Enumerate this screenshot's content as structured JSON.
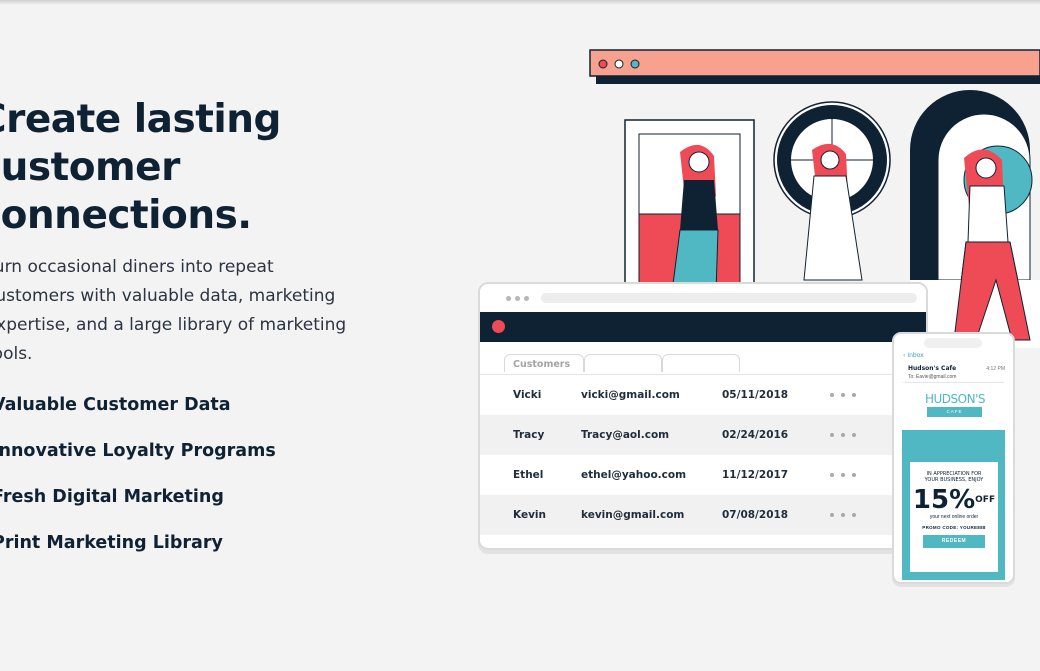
{
  "hero": {
    "title_lines": [
      "Create lasting",
      "customer",
      "connections."
    ],
    "copy_lines": [
      "Turn occasional diners into repeat",
      "customers with valuable data, marketing",
      "expertise, and a large library of marketing",
      "tools."
    ]
  },
  "features": [
    "Valuable Customer Data",
    "Innovative Loyalty Programs",
    "Fresh Digital Marketing",
    "Print Marketing Library"
  ],
  "dashboard": {
    "tabs": [
      "Customers",
      "",
      ""
    ],
    "rows": [
      {
        "name": "Vicki",
        "email": "vicki@gmail.com",
        "date": "05/11/2018"
      },
      {
        "name": "Tracy",
        "email": "Tracy@aol.com",
        "date": "02/24/2016"
      },
      {
        "name": "Ethel",
        "email": "ethel@yahoo.com",
        "date": "11/12/2017"
      },
      {
        "name": "Kevin",
        "email": "kevin@gmail.com",
        "date": "07/08/2018"
      }
    ]
  },
  "phone": {
    "back_label": "Inbox",
    "sender": "Hudson's Cafe",
    "time": "4:12 PM",
    "to": "To: Eavie@gmail.com",
    "logo": "HUDSON'S",
    "logo_sub": "CAFE",
    "appreciation": [
      "IN APPRECIATION FOR",
      "YOUR BUSINESS, ENJOY"
    ],
    "discount": "15",
    "discount_symbol": "%",
    "discount_off": "OFF",
    "next_order": "your next online order",
    "promo": "PROMO CODE: YOURE888",
    "redeem": "REDEEM"
  },
  "colors": {
    "navy": "#0f2233",
    "coral": "#ef4b56",
    "salmon": "#f8a18f",
    "teal": "#4fb8c2",
    "background": "#f3f3f3"
  }
}
